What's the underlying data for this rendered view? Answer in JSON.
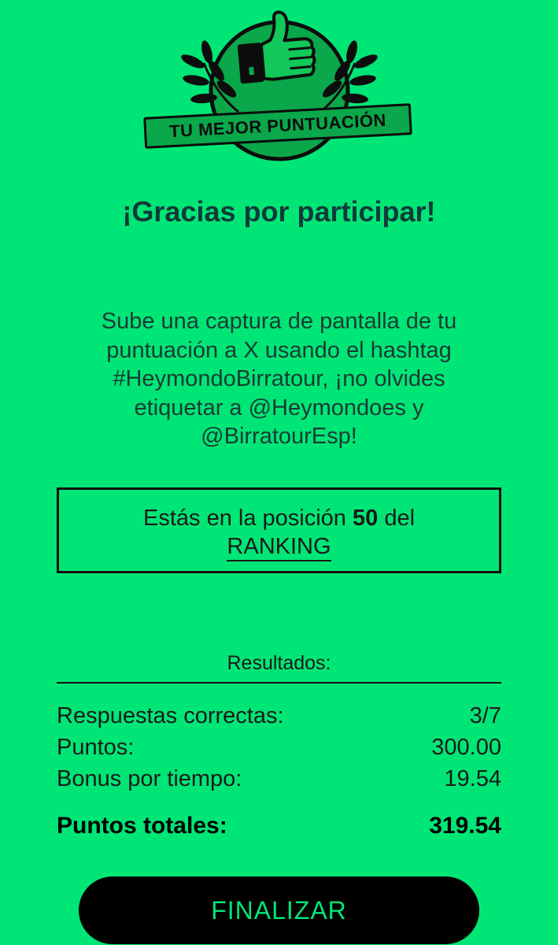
{
  "badge": {
    "label": "TU MEJOR PUNTUACIÓN",
    "icon": "thumbs-up-icon"
  },
  "title": "¡Gracias por participar!",
  "message": {
    "lines": [
      "Sube una captura de pantalla de tu",
      "puntuación a X usando el hashtag",
      "#HeymondoBirratour, ¡no olvides",
      "etiquetar a @Heymondoes y",
      "@BirratourEsp!"
    ]
  },
  "ranking": {
    "prefix": "Estás en la posición",
    "position": "50",
    "suffix": "del",
    "link_label": "RANKING"
  },
  "results": {
    "heading": "Resultados:",
    "rows": [
      {
        "label": "Respuestas correctas:",
        "value": "3/7"
      },
      {
        "label": "Puntos:",
        "value": "300.00"
      },
      {
        "label": "Bonus por tiempo:",
        "value": "19.54"
      }
    ],
    "total": {
      "label": "Puntos totales:",
      "value": "319.54"
    }
  },
  "finish_button": "FINALIZAR",
  "colors": {
    "background": "#00e676",
    "title": "#123a3a",
    "button_bg": "#000000",
    "button_text": "#00e676"
  }
}
